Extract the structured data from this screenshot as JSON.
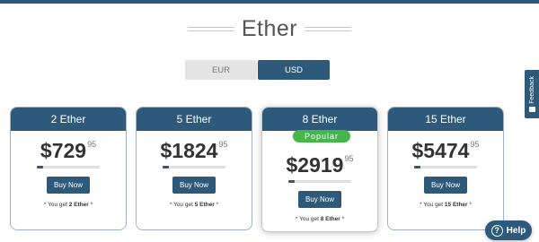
{
  "title": "Ether",
  "currency": {
    "options": [
      {
        "label": "EUR",
        "selected": false
      },
      {
        "label": "USD",
        "selected": true
      }
    ]
  },
  "cards": [
    {
      "name": "2 Ether",
      "currency_symbol": "$",
      "price": "729",
      "cents": "95",
      "progress": 0.1,
      "button": "Buy Now",
      "you_get_prefix": "* You get ",
      "you_get_amount": "2 Ether",
      "you_get_suffix": " *",
      "badge": ""
    },
    {
      "name": "5 Ether",
      "currency_symbol": "$",
      "price": "1824",
      "cents": "95",
      "progress": 0.1,
      "button": "Buy Now",
      "you_get_prefix": "* You get ",
      "you_get_amount": "5 Ether",
      "you_get_suffix": " *",
      "badge": ""
    },
    {
      "name": "8 Ether",
      "currency_symbol": "$",
      "price": "2919",
      "cents": "95",
      "progress": 0.1,
      "button": "Buy Now",
      "you_get_prefix": "* You get ",
      "you_get_amount": "8 Ether",
      "you_get_suffix": " *",
      "badge": "Popular"
    },
    {
      "name": "15 Ether",
      "currency_symbol": "$",
      "price": "5474",
      "cents": "95",
      "progress": 0.1,
      "button": "Buy Now",
      "you_get_prefix": "* You get ",
      "you_get_amount": "15 Ether",
      "you_get_suffix": " *",
      "badge": ""
    }
  ],
  "feedback": {
    "label": "Feedback"
  },
  "help": {
    "label": "Help",
    "icon": "question-icon"
  },
  "colors": {
    "primary": "#2d5a7b",
    "badge": "#45b649",
    "toggle_inactive": "#e4e4e4"
  }
}
